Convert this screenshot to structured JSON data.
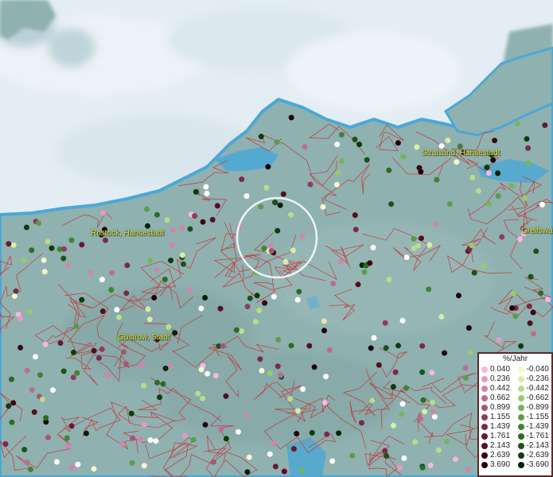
{
  "map": {
    "cities": [
      {
        "name": "Rostock, Hansestadt"
      },
      {
        "name": "Stralsund, Hansestadt"
      },
      {
        "name": "Greifswald"
      },
      {
        "name": "Güstrow, Stadt"
      }
    ],
    "highlight": {
      "shape": "circle",
      "color": "#ffffff"
    },
    "colors": {
      "sea": "#dfe9ef",
      "land": "#8fb1b0",
      "borders": "#c23b3b",
      "water": "#4aa8d6"
    }
  },
  "legend": {
    "title": "%/Jahr",
    "positive": [
      {
        "label": "0.040",
        "color": "#f4b8e2"
      },
      {
        "label": "0.236",
        "color": "#e59ac6"
      },
      {
        "label": "0.442",
        "color": "#cf86ab"
      },
      {
        "label": "0.662",
        "color": "#bb6d8f"
      },
      {
        "label": "0.899",
        "color": "#a55575"
      },
      {
        "label": "1.155",
        "color": "#8e3c5c"
      },
      {
        "label": "1.439",
        "color": "#7a2a44"
      },
      {
        "label": "1.761",
        "color": "#661a30"
      },
      {
        "label": "2.143",
        "color": "#521020"
      },
      {
        "label": "2.639",
        "color": "#3a0812"
      },
      {
        "label": "3.690",
        "color": "#200308"
      }
    ],
    "negative": [
      {
        "label": "-0.040",
        "color": "#f3f8cf"
      },
      {
        "label": "-0.236",
        "color": "#d9eda8"
      },
      {
        "label": "-0.442",
        "color": "#b8dd8a"
      },
      {
        "label": "-0.662",
        "color": "#97cb72"
      },
      {
        "label": "-0.899",
        "color": "#77b45c"
      },
      {
        "label": "-1.155",
        "color": "#5a9c48"
      },
      {
        "label": "-1.439",
        "color": "#418337"
      },
      {
        "label": "-1.761",
        "color": "#2c6a27"
      },
      {
        "label": "-2.143",
        "color": "#1b531a"
      },
      {
        "label": "-2.639",
        "color": "#0e3b0e"
      },
      {
        "label": "-3.690",
        "color": "#042204"
      }
    ]
  }
}
